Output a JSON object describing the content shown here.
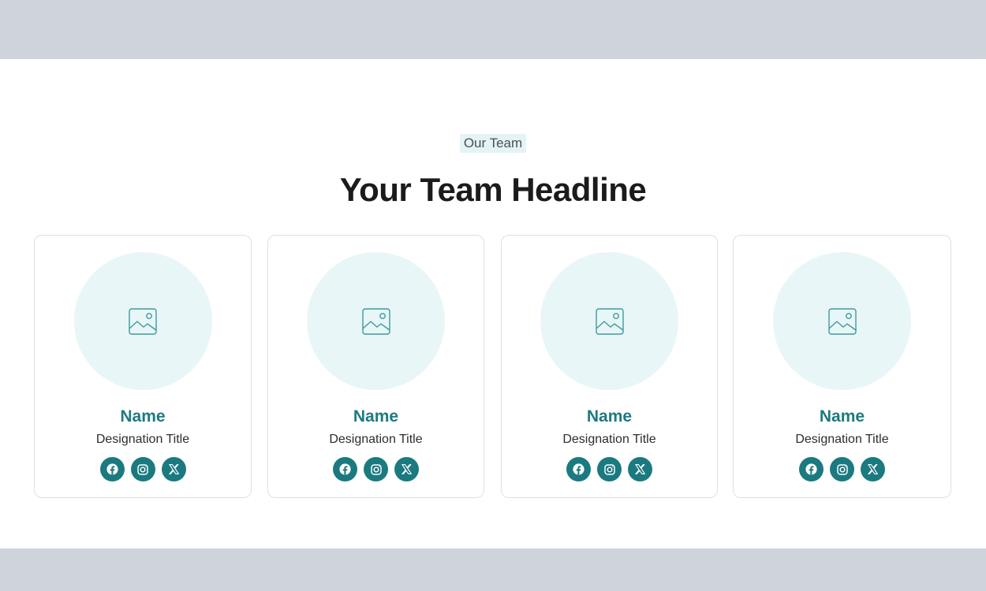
{
  "section": {
    "eyebrow": "Our Team",
    "headline": "Your Team Headline"
  },
  "members": [
    {
      "name": "Name",
      "designation": "Designation Title",
      "avatar_icon": "image-placeholder-icon",
      "socials": [
        "facebook-icon",
        "instagram-icon",
        "x-icon"
      ]
    },
    {
      "name": "Name",
      "designation": "Designation Title",
      "avatar_icon": "image-placeholder-icon",
      "socials": [
        "facebook-icon",
        "instagram-icon",
        "x-icon"
      ]
    },
    {
      "name": "Name",
      "designation": "Designation Title",
      "avatar_icon": "image-placeholder-icon",
      "socials": [
        "facebook-icon",
        "instagram-icon",
        "x-icon"
      ]
    },
    {
      "name": "Name",
      "designation": "Designation Title",
      "avatar_icon": "image-placeholder-icon",
      "socials": [
        "facebook-icon",
        "instagram-icon",
        "x-icon"
      ]
    }
  ],
  "colors": {
    "page_background": "#cfd4db",
    "accent": "#1b7a80",
    "avatar_background": "#e8f6f7",
    "eyebrow_background": "#e4f4f6",
    "headline": "#1b1b1d"
  }
}
